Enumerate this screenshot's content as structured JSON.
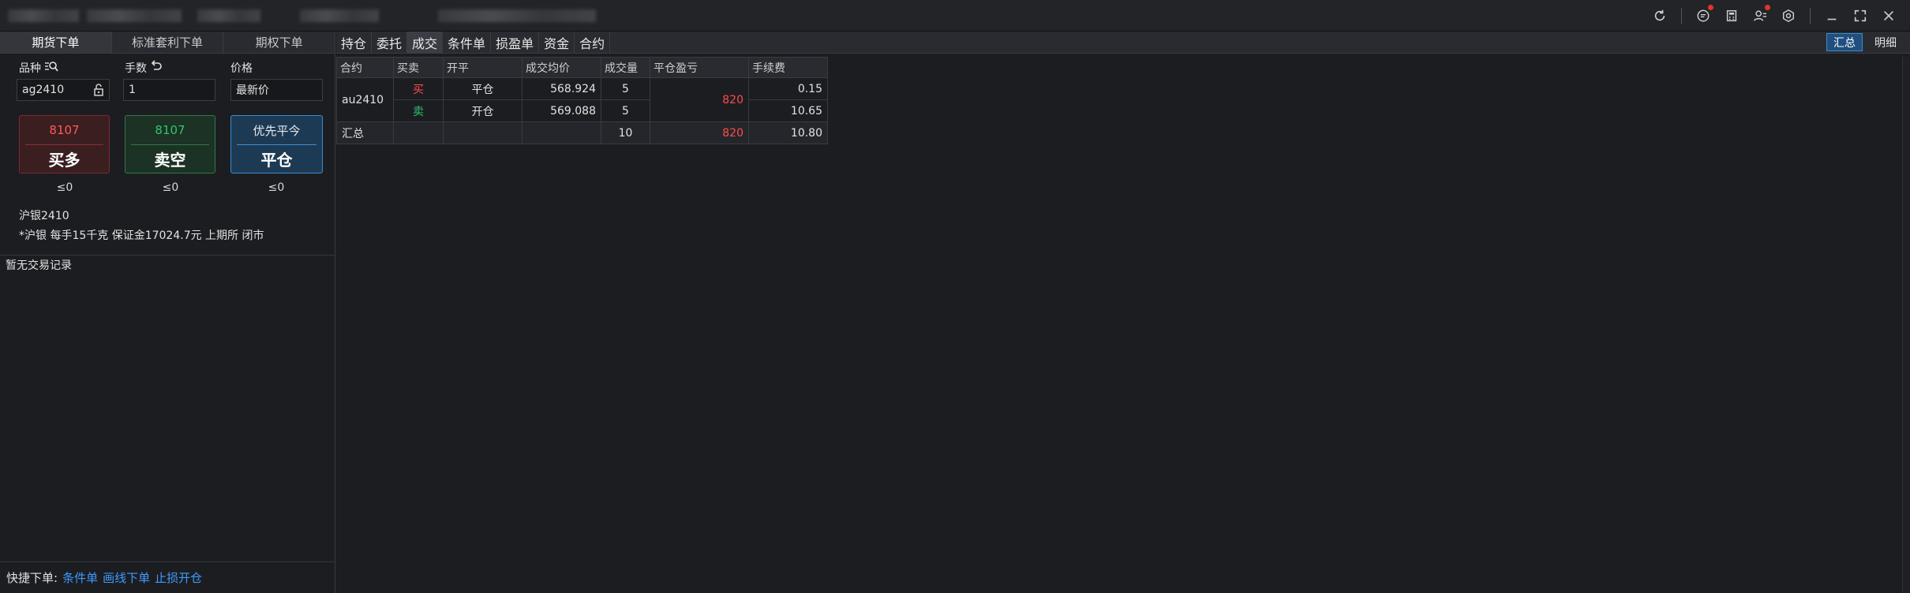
{
  "left_tabs": [
    "期货下单",
    "标准套利下单",
    "期权下单"
  ],
  "order_form": {
    "symbol_label": "品种",
    "qty_label": "手数",
    "price_label": "价格",
    "symbol_value": "ag2410",
    "qty_value": "1",
    "price_value": "最新价"
  },
  "buttons": {
    "buy": {
      "price": "8107",
      "label": "买多",
      "limit": "≤0"
    },
    "sell": {
      "price": "8107",
      "label": "卖空",
      "limit": "≤0"
    },
    "close": {
      "price": "优先平今",
      "label": "平仓",
      "limit": "≤0"
    }
  },
  "contract_info": {
    "name": "沪银2410",
    "detail": "*沪银 每手15千克 保证金17024.7元 上期所 闭市"
  },
  "no_records": "暂无交易记录",
  "quick_order": {
    "label": "快捷下单:",
    "links": [
      "条件单",
      "画线下单",
      "止损开仓"
    ]
  },
  "right_tabs": [
    "持仓",
    "委托",
    "成交",
    "条件单",
    "损盈单",
    "资金",
    "合约"
  ],
  "active_right_tab": "成交",
  "view_toggle": {
    "summary": "汇总",
    "detail": "明细"
  },
  "table": {
    "headers": [
      "合约",
      "买卖",
      "开平",
      "成交均价",
      "成交量",
      "平仓盈亏",
      "手续费"
    ],
    "group": {
      "contract": "au2410",
      "pnl": "820",
      "rows": [
        {
          "side": "买",
          "openclose": "平仓",
          "avg_price": "568.924",
          "volume": "5",
          "fee": "0.15"
        },
        {
          "side": "卖",
          "openclose": "开仓",
          "avg_price": "569.088",
          "volume": "5",
          "fee": "10.65"
        }
      ]
    },
    "summary": {
      "label": "汇总",
      "volume": "10",
      "pnl": "820",
      "fee": "10.80"
    }
  },
  "colors": {
    "buy": "#ff4b4b",
    "sell": "#2fc26b",
    "accent": "#3c8cd0",
    "link": "#3d9bff"
  }
}
